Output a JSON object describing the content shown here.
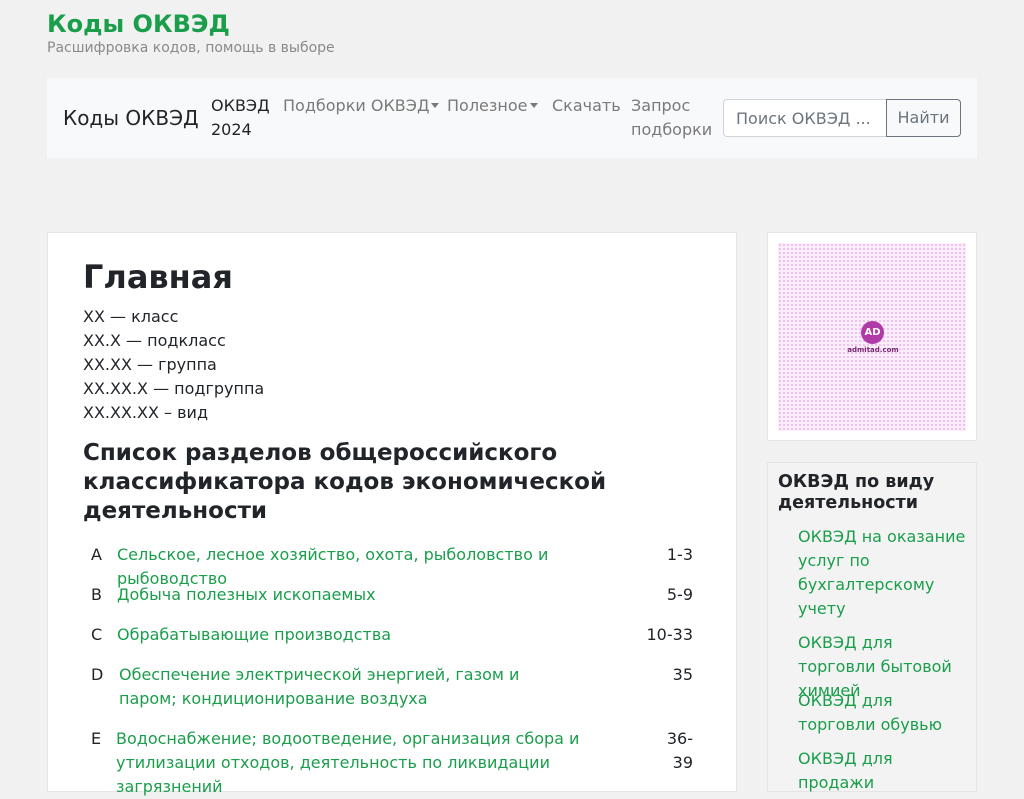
{
  "site": {
    "title": "Коды ОКВЭД",
    "tagline": "Расшифровка кодов, помощь в выборе"
  },
  "navbar": {
    "brand": "Коды ОКВЭД",
    "items": [
      {
        "label": "ОКВЭД 2024",
        "active": true,
        "dropdown": false
      },
      {
        "label": "Подборки ОКВЭД",
        "active": false,
        "dropdown": true
      },
      {
        "label": "Полезное",
        "active": false,
        "dropdown": true
      },
      {
        "label": "Скачать",
        "active": false,
        "dropdown": false
      },
      {
        "label": "Запрос подборки",
        "active": false,
        "dropdown": false
      }
    ],
    "search": {
      "placeholder": "Поиск ОКВЭД ...",
      "button": "Найти"
    }
  },
  "main": {
    "title": "Главная",
    "legend": [
      "XX — класс",
      "XX.X — подкласс",
      "XX.XX — группа",
      "XX.XX.X — подгруппа",
      "XX.XX.XX – вид"
    ],
    "sections_heading": "Список разделов общероссийского классификатора кодов экономической деятельности",
    "sections": [
      {
        "letter": "A",
        "name": "Сельское, лесное хозяйство, охота, рыболовство и рыбоводство",
        "range": "1-3"
      },
      {
        "letter": "B",
        "name": "Добыча полезных ископаемых",
        "range": "5-9"
      },
      {
        "letter": "C",
        "name": "Обрабатывающие производства",
        "range": "10-33"
      },
      {
        "letter": "D",
        "name": "Обеспечение электрической энергией, газом и паром; кондиционирование воздуха",
        "range": "35"
      },
      {
        "letter": "E",
        "name": "Водоснабжение; водоотведение, организация сбора и утилизации отходов, деятельность по ликвидации загрязнений",
        "range": "36-39"
      }
    ]
  },
  "ad": {
    "label": "admitad.com",
    "logo": "AD"
  },
  "sidebar": {
    "title": "ОКВЭД по виду деятельности",
    "links": [
      "ОКВЭД на оказание услуг по бухгалтерскому учету",
      "ОКВЭД для торговли бытовой химией",
      "ОКВЭД для торговли обувью",
      "ОКВЭД для продажи"
    ]
  },
  "colors": {
    "accent": "#1a9e4b",
    "muted": "#7a7a7a",
    "navbar_bg": "#f8f9fa"
  }
}
